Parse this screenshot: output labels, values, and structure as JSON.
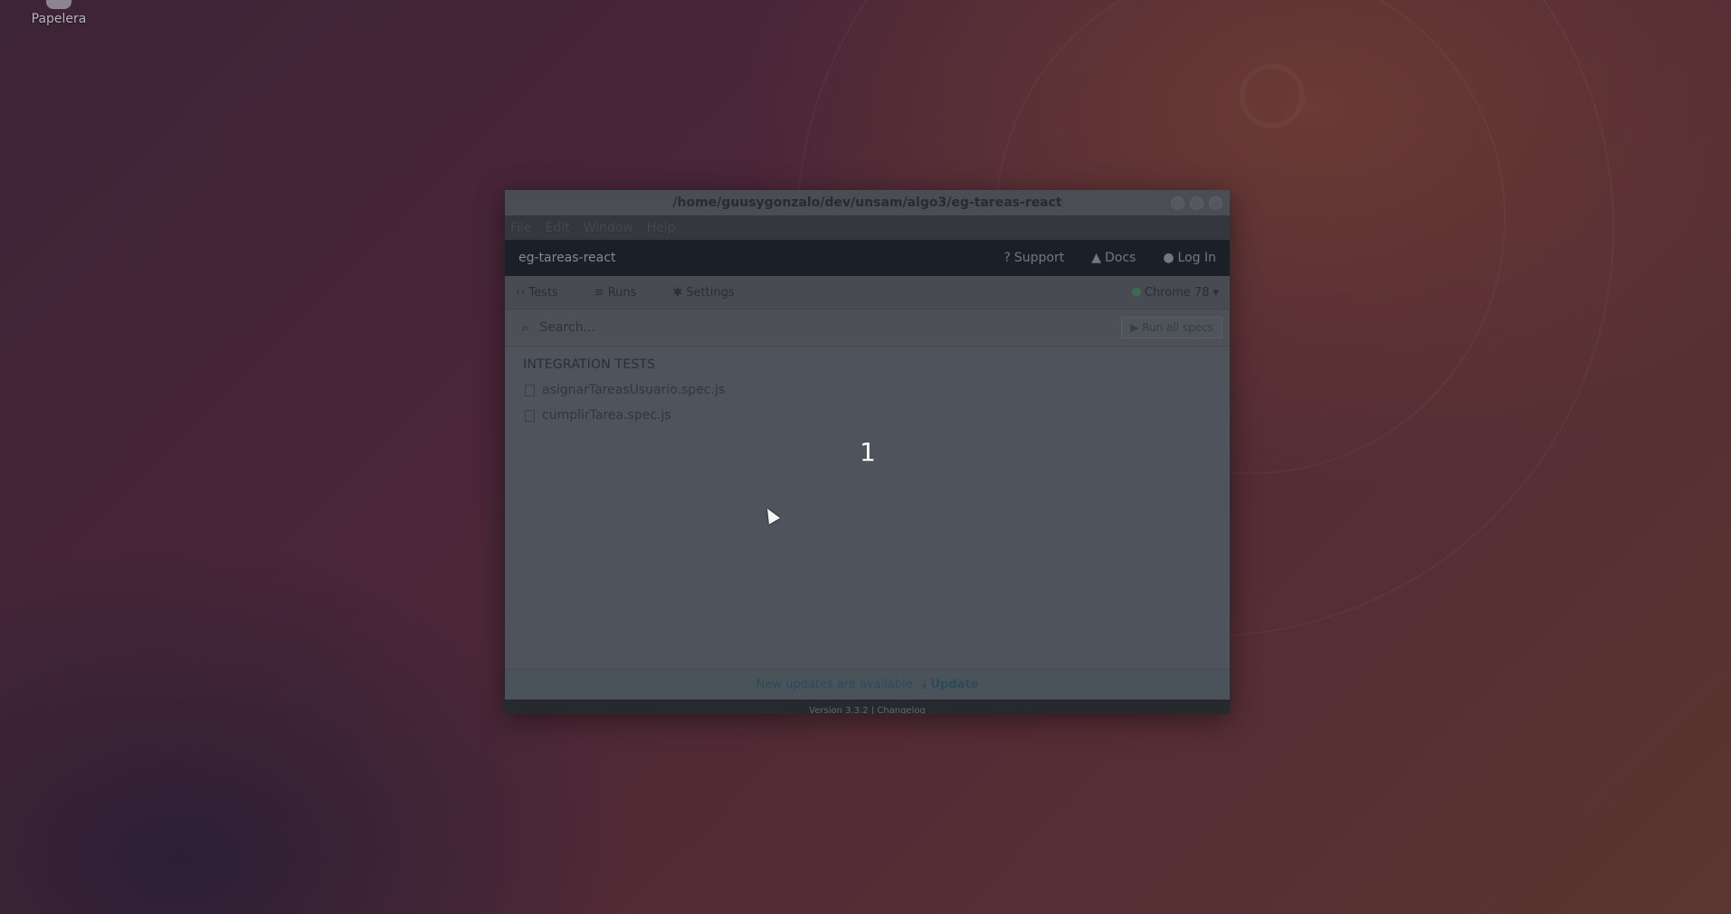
{
  "desktop": {
    "trash_label": "Papelera"
  },
  "window": {
    "title": "/home/guusygonzalo/dev/unsam/algo3/eg-tareas-react",
    "menu": [
      "File",
      "Edit",
      "Window",
      "Help"
    ]
  },
  "header": {
    "project_name": "eg-tareas-react",
    "nav": {
      "support": "Support",
      "docs": "Docs",
      "login": "Log In"
    }
  },
  "tabs": {
    "tests": "Tests",
    "runs": "Runs",
    "settings": "Settings",
    "browser": "Chrome 78"
  },
  "search": {
    "placeholder": "Search...",
    "run_all": "Run all specs"
  },
  "specs": {
    "section_title": "INTEGRATION TESTS",
    "files": [
      "asignarTareasUsuario.spec.js",
      "cumplirTarea.spec.js"
    ]
  },
  "overlay_counter": "1",
  "update_bar": {
    "message": "New updates are available",
    "action": "Update"
  },
  "footer": {
    "version": "Version 3.3.2 | Changelog"
  }
}
